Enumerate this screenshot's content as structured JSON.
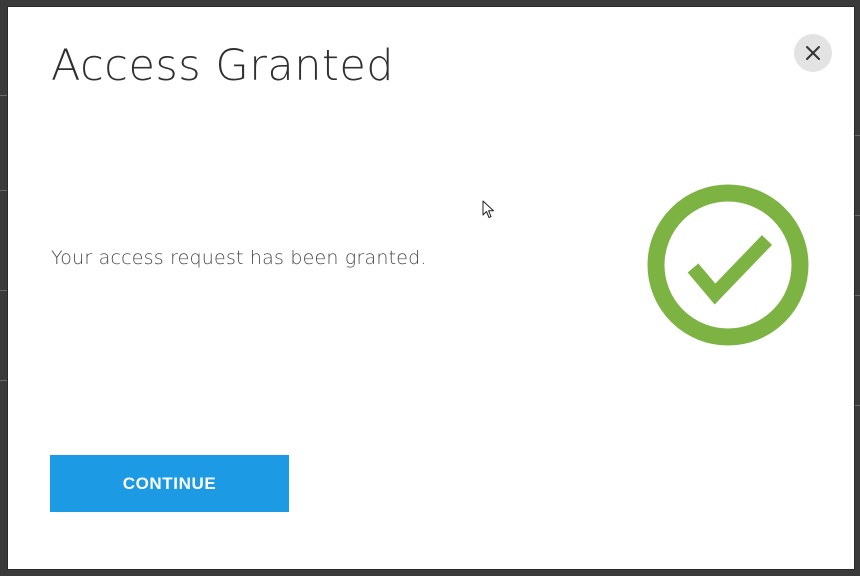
{
  "dialog": {
    "title": "Access Granted",
    "message": "Your access request has been granted.",
    "continue_label": "CONTINUE",
    "close_icon": "close-icon",
    "status_icon": "check-circle-icon"
  },
  "colors": {
    "primary_button": "#1c9ae3",
    "success": "#7cb342",
    "title_text": "#303030",
    "body_text": "#4a4a4a",
    "close_button_bg": "#e3e3e3"
  }
}
